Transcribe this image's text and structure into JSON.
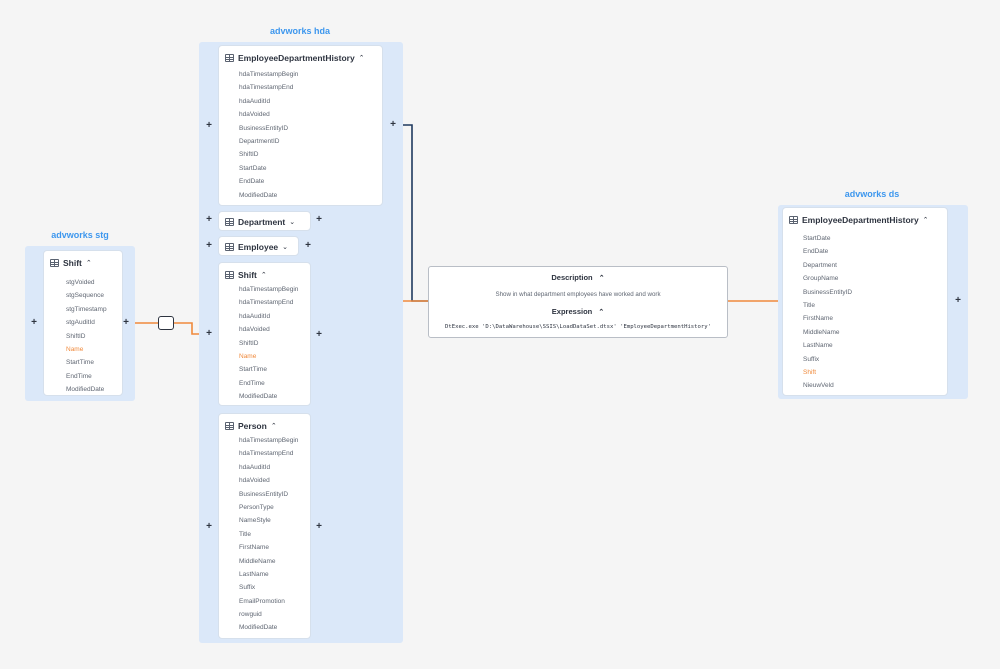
{
  "groups": {
    "hda": {
      "title": "advworks hda"
    },
    "stg": {
      "title": "advworks stg"
    },
    "ds": {
      "title": "advworks ds"
    }
  },
  "tables": {
    "stg_shift": {
      "name": "Shift",
      "fields": [
        "stgVoided",
        "stgSequence",
        "stgTimestamp",
        "stgAuditId",
        "ShiftID",
        "Name",
        "StartTime",
        "EndTime",
        "ModifiedDate"
      ],
      "highlight": [
        "Name"
      ]
    },
    "hda_edh": {
      "name": "EmployeeDepartmentHistory",
      "fields": [
        "hdaTimestampBegin",
        "hdaTimestampEnd",
        "hdaAuditId",
        "hdaVoided",
        "BusinessEntityID",
        "DepartmentID",
        "ShiftID",
        "StartDate",
        "EndDate",
        "ModifiedDate"
      ],
      "highlight": []
    },
    "hda_department": {
      "name": "Department",
      "fields": [],
      "highlight": []
    },
    "hda_employee": {
      "name": "Employee",
      "fields": [],
      "highlight": []
    },
    "hda_shift": {
      "name": "Shift",
      "fields": [
        "hdaTimestampBegin",
        "hdaTimestampEnd",
        "hdaAuditId",
        "hdaVoided",
        "ShiftID",
        "Name",
        "StartTime",
        "EndTime",
        "ModifiedDate"
      ],
      "highlight": [
        "Name"
      ]
    },
    "hda_person": {
      "name": "Person",
      "fields": [
        "hdaTimestampBegin",
        "hdaTimestampEnd",
        "hdaAuditId",
        "hdaVoided",
        "BusinessEntityID",
        "PersonType",
        "NameStyle",
        "Title",
        "FirstName",
        "MiddleName",
        "LastName",
        "Suffix",
        "EmailPromotion",
        "rowguid",
        "ModifiedDate"
      ],
      "highlight": []
    },
    "ds_edh": {
      "name": "EmployeeDepartmentHistory",
      "fields": [
        "StartDate",
        "EndDate",
        "Department",
        "GroupName",
        "BusinessEntityID",
        "Title",
        "FirstName",
        "MiddleName",
        "LastName",
        "Suffix",
        "Shift",
        "NieuwVeld"
      ],
      "highlight": [
        "Shift"
      ]
    }
  },
  "process": {
    "description_label": "Description",
    "description_text": "Show in what department employees have worked and work",
    "expression_label": "Expression",
    "expression_code": "DtExec.exe 'D:\\DataWarehouse\\SSIS\\LoadDataSet.dtsx' 'EmployeeDepartmentHistory'"
  },
  "icons": {
    "table": "table-icon",
    "expand": "plus-icon",
    "collapse": "chevron-up-icon",
    "expand_down": "chevron-down-icon"
  },
  "colors": {
    "lineage_highlight": "#f08a3c",
    "lineage_default": "#1f3a5f",
    "group_bg": "#dbe8f9",
    "group_title": "#3d97ee"
  }
}
